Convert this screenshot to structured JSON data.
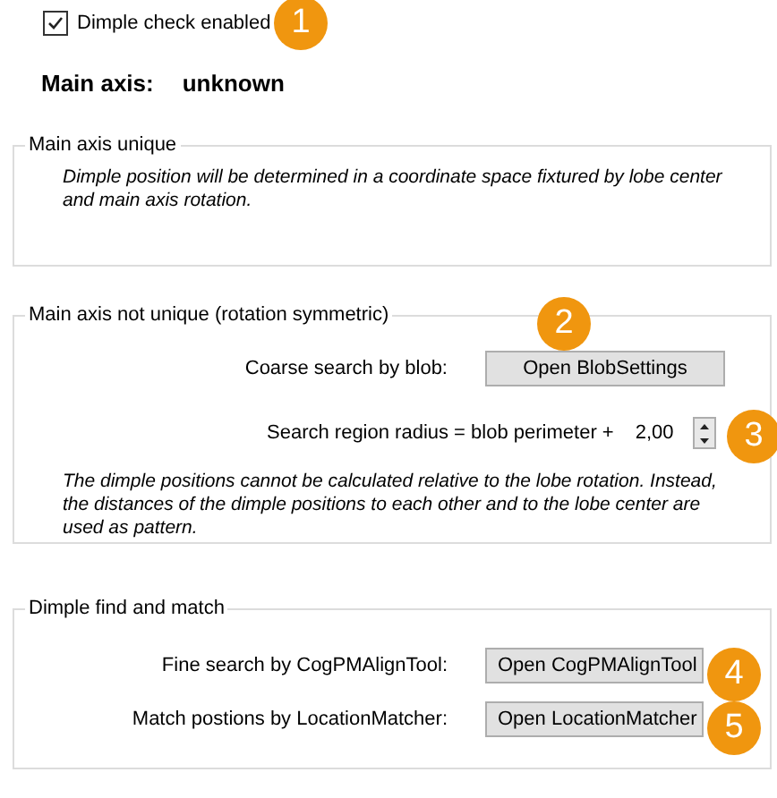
{
  "dimple_check": {
    "label": "Dimple check enabled",
    "checked": true,
    "badge": "1"
  },
  "main_axis": {
    "label": "Main axis:",
    "value": "unknown"
  },
  "unique_group": {
    "title": "Main axis unique",
    "note": "Dimple position will be determined in a coordinate space fixtured by lobe center and main axis rotation."
  },
  "symmetric_group": {
    "title": "Main axis not unique (rotation symmetric)",
    "badge": "2",
    "coarse_search": {
      "label": "Coarse search by blob:",
      "button": "Open BlobSettings"
    },
    "radius": {
      "label": "Search region radius = blob perimeter +",
      "value": "2,00",
      "badge": "3"
    },
    "note": "The dimple positions cannot be calculated relative to the lobe rotation. Instead, the distances of the dimple positions to each other and to the lobe center are used as pattern."
  },
  "match_group": {
    "title": "Dimple find and match",
    "rows": [
      {
        "label": "Fine search by CogPMAlignTool:",
        "button": "Open CogPMAlignTool",
        "badge": "4"
      },
      {
        "label": "Match postions by LocationMatcher:",
        "button": "Open LocationMatcher",
        "badge": "5"
      }
    ]
  }
}
